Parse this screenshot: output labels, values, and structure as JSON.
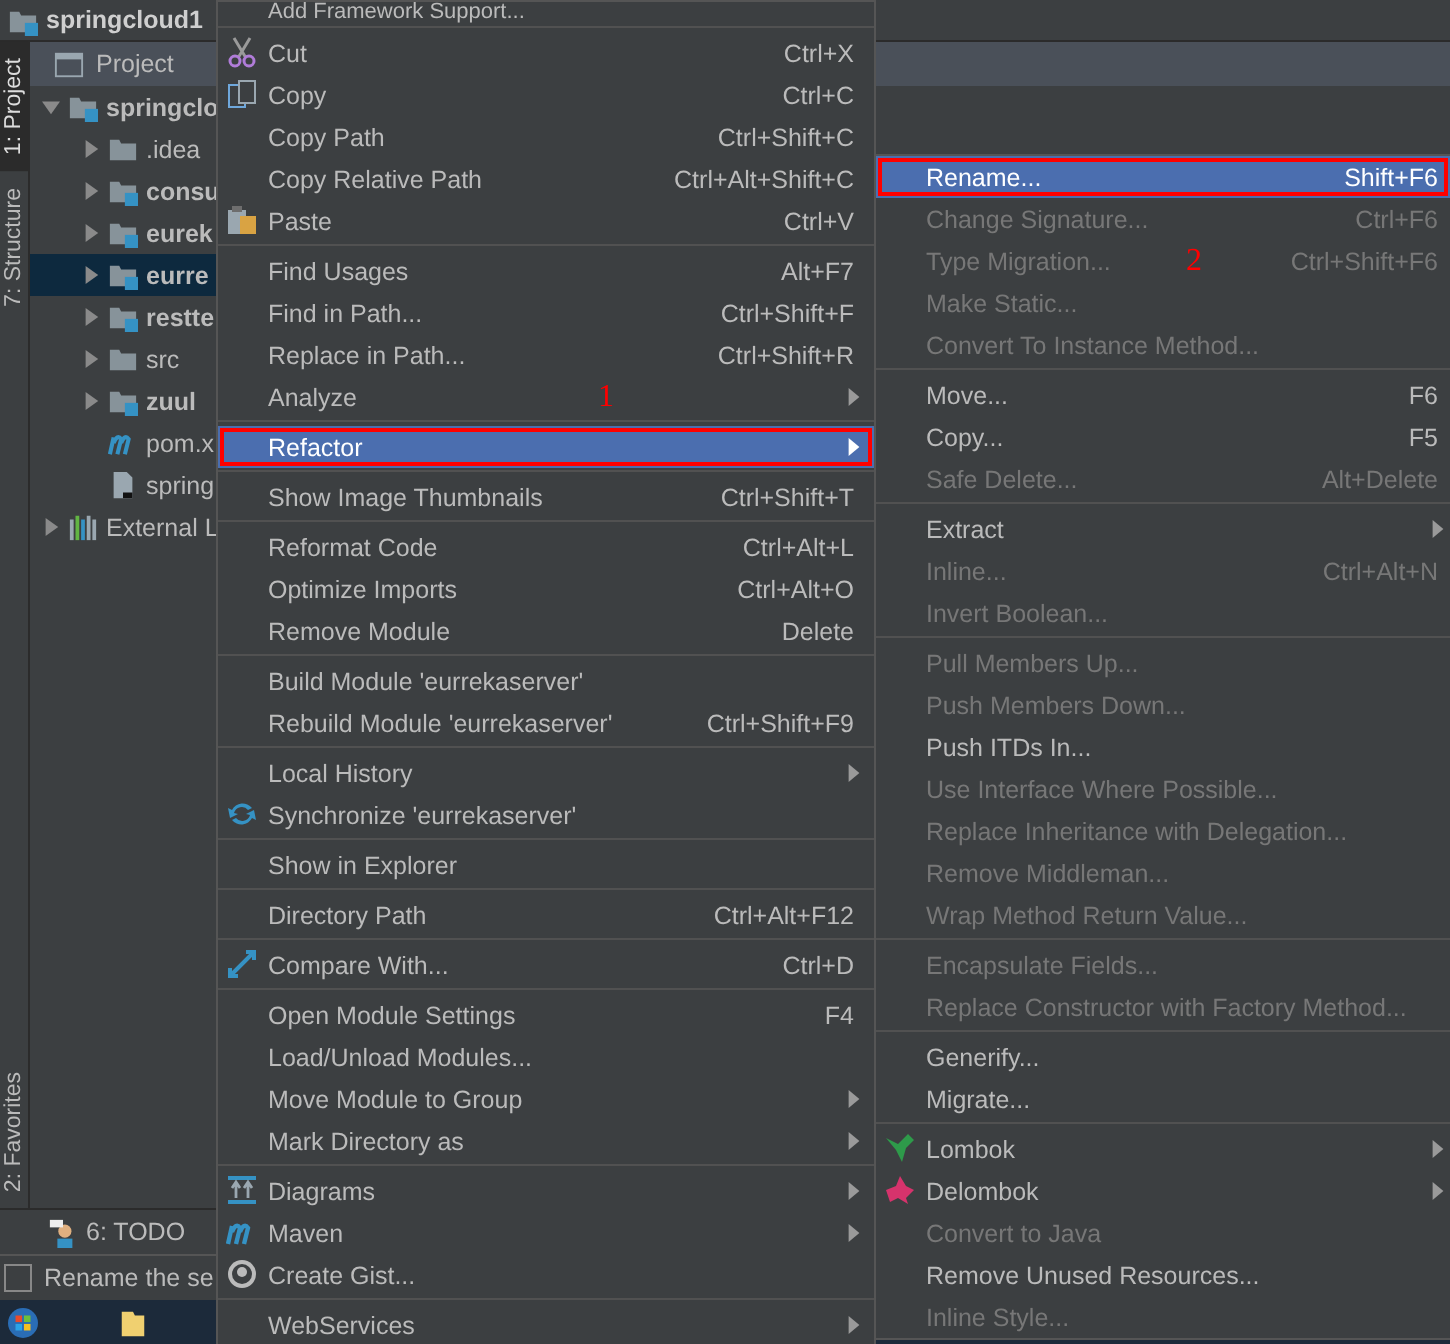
{
  "window": {
    "title": "springcloud1"
  },
  "tool_strip": {
    "top": [
      {
        "label": "1: Project",
        "selected": true
      },
      {
        "label": "7: Structure",
        "selected": false
      }
    ],
    "bottom": [
      {
        "label": "2: Favorites",
        "selected": false
      }
    ]
  },
  "project_panel": {
    "title": "Project",
    "tree": [
      {
        "label": "springclo",
        "kind": "module",
        "expanded": true,
        "selected": false,
        "children": [
          {
            "label": ".idea",
            "kind": "folder",
            "expanded": false,
            "selected": false
          },
          {
            "label": "consu",
            "kind": "module",
            "expanded": false,
            "selected": false
          },
          {
            "label": "eurek",
            "kind": "module",
            "expanded": false,
            "selected": false
          },
          {
            "label": "eurre",
            "kind": "module",
            "expanded": false,
            "selected": true
          },
          {
            "label": "restte",
            "kind": "module",
            "expanded": false,
            "selected": false
          },
          {
            "label": "src",
            "kind": "folder",
            "expanded": false,
            "selected": false
          },
          {
            "label": "zuul",
            "kind": "module",
            "expanded": false,
            "selected": false
          },
          {
            "label": "pom.x",
            "kind": "maven",
            "selected": false
          },
          {
            "label": "spring",
            "kind": "file",
            "selected": false
          }
        ]
      },
      {
        "label": "External L",
        "kind": "library",
        "expanded": false,
        "selected": false
      }
    ]
  },
  "tool_window_bar": {
    "tabs": [
      {
        "label": "6: TODO"
      }
    ]
  },
  "status_bar": {
    "text": "Rename the se"
  },
  "context_menu": {
    "groups": [
      [
        {
          "label": "Add Framework Support...",
          "kind": "cut"
        }
      ],
      [
        {
          "label": "Cut",
          "shortcut": "Ctrl+X",
          "disabled": false,
          "submenu": false,
          "selected": false
        },
        {
          "label": "Copy",
          "shortcut": "Ctrl+C",
          "disabled": false,
          "submenu": false,
          "selected": false
        },
        {
          "label": "Copy Path",
          "shortcut": "Ctrl+Shift+C",
          "disabled": false,
          "submenu": false,
          "selected": false
        },
        {
          "label": "Copy Relative Path",
          "shortcut": "Ctrl+Alt+Shift+C",
          "disabled": false,
          "submenu": false,
          "selected": false
        },
        {
          "label": "Paste",
          "shortcut": "Ctrl+V",
          "disabled": false,
          "submenu": false,
          "selected": false
        }
      ],
      [
        {
          "label": "Find Usages",
          "shortcut": "Alt+F7",
          "disabled": false,
          "submenu": false,
          "selected": false
        },
        {
          "label": "Find in Path...",
          "shortcut": "Ctrl+Shift+F",
          "disabled": false,
          "submenu": false,
          "selected": false
        },
        {
          "label": "Replace in Path...",
          "shortcut": "Ctrl+Shift+R",
          "disabled": false,
          "submenu": false,
          "selected": false
        },
        {
          "label": "Analyze",
          "annotation": "1",
          "disabled": false,
          "submenu": true,
          "selected": false
        }
      ],
      [
        {
          "label": "Refactor",
          "disabled": false,
          "submenu": true,
          "selected": true
        }
      ],
      [
        {
          "label": "Show Image Thumbnails",
          "shortcut": "Ctrl+Shift+T",
          "disabled": false,
          "submenu": false,
          "selected": false
        }
      ],
      [
        {
          "label": "Reformat Code",
          "shortcut": "Ctrl+Alt+L",
          "disabled": false,
          "submenu": false,
          "selected": false
        },
        {
          "label": "Optimize Imports",
          "shortcut": "Ctrl+Alt+O",
          "disabled": false,
          "submenu": false,
          "selected": false
        },
        {
          "label": "Remove Module",
          "shortcut": "Delete",
          "disabled": false,
          "submenu": false,
          "selected": false
        }
      ],
      [
        {
          "label": "Build Module 'eurrekaserver'",
          "disabled": false,
          "submenu": false,
          "selected": false
        },
        {
          "label": "Rebuild Module 'eurrekaserver'",
          "shortcut": "Ctrl+Shift+F9",
          "disabled": false,
          "submenu": false,
          "selected": false
        }
      ],
      [
        {
          "label": "Local History",
          "disabled": false,
          "submenu": true,
          "selected": false
        },
        {
          "label": "Synchronize 'eurrekaserver'",
          "disabled": false,
          "submenu": false,
          "selected": false
        }
      ],
      [
        {
          "label": "Show in Explorer",
          "disabled": false,
          "submenu": false,
          "selected": false
        }
      ],
      [
        {
          "label": "Directory Path",
          "shortcut": "Ctrl+Alt+F12",
          "disabled": false,
          "submenu": false,
          "selected": false
        }
      ],
      [
        {
          "label": "Compare With...",
          "shortcut": "Ctrl+D",
          "disabled": false,
          "submenu": false,
          "selected": false
        }
      ],
      [
        {
          "label": "Open Module Settings",
          "shortcut": "F4",
          "disabled": false,
          "submenu": false,
          "selected": false
        },
        {
          "label": "Load/Unload Modules...",
          "disabled": false,
          "submenu": false,
          "selected": false
        },
        {
          "label": "Move Module to Group",
          "disabled": false,
          "submenu": true,
          "selected": false
        },
        {
          "label": "Mark Directory as",
          "disabled": false,
          "submenu": true,
          "selected": false
        }
      ],
      [
        {
          "label": "Diagrams",
          "disabled": false,
          "submenu": true,
          "selected": false
        },
        {
          "label": "Maven",
          "disabled": false,
          "submenu": true,
          "selected": false
        },
        {
          "label": "Create Gist...",
          "disabled": false,
          "submenu": false,
          "selected": false
        }
      ],
      [
        {
          "label": "WebServices",
          "disabled": false,
          "submenu": true,
          "selected": false
        }
      ]
    ]
  },
  "refactor_submenu": {
    "groups": [
      [
        {
          "label": "Rename...",
          "shortcut": "Shift+F6",
          "disabled": false,
          "submenu": false,
          "selected": true
        },
        {
          "label": "Change Signature...",
          "shortcut": "Ctrl+F6",
          "disabled": true,
          "submenu": false,
          "selected": false
        },
        {
          "label": "Type Migration...",
          "shortcut": "Ctrl+Shift+F6",
          "annotation": "2",
          "disabled": true,
          "submenu": false,
          "selected": false
        },
        {
          "label": "Make Static...",
          "disabled": true,
          "submenu": false,
          "selected": false
        },
        {
          "label": "Convert To Instance Method...",
          "disabled": true,
          "submenu": false,
          "selected": false
        }
      ],
      [
        {
          "label": "Move...",
          "shortcut": "F6",
          "disabled": false,
          "submenu": false,
          "selected": false
        },
        {
          "label": "Copy...",
          "shortcut": "F5",
          "disabled": false,
          "submenu": false,
          "selected": false
        },
        {
          "label": "Safe Delete...",
          "shortcut": "Alt+Delete",
          "disabled": true,
          "submenu": false,
          "selected": false
        }
      ],
      [
        {
          "label": "Extract",
          "disabled": false,
          "submenu": true,
          "selected": false
        },
        {
          "label": "Inline...",
          "shortcut": "Ctrl+Alt+N",
          "disabled": true,
          "submenu": false,
          "selected": false
        },
        {
          "label": "Invert Boolean...",
          "disabled": true,
          "submenu": false,
          "selected": false
        }
      ],
      [
        {
          "label": "Pull Members Up...",
          "disabled": true,
          "submenu": false,
          "selected": false
        },
        {
          "label": "Push Members Down...",
          "disabled": true,
          "submenu": false,
          "selected": false
        },
        {
          "label": "Push ITDs In...",
          "disabled": false,
          "submenu": false,
          "selected": false
        },
        {
          "label": "Use Interface Where Possible...",
          "disabled": true,
          "submenu": false,
          "selected": false
        },
        {
          "label": "Replace Inheritance with Delegation...",
          "disabled": true,
          "submenu": false,
          "selected": false
        },
        {
          "label": "Remove Middleman...",
          "disabled": true,
          "submenu": false,
          "selected": false
        },
        {
          "label": "Wrap Method Return Value...",
          "disabled": true,
          "submenu": false,
          "selected": false
        }
      ],
      [
        {
          "label": "Encapsulate Fields...",
          "disabled": true,
          "submenu": false,
          "selected": false
        },
        {
          "label": "Replace Constructor with Factory Method...",
          "disabled": true,
          "submenu": false,
          "selected": false
        }
      ],
      [
        {
          "label": "Generify...",
          "disabled": false,
          "submenu": false,
          "selected": false
        },
        {
          "label": "Migrate...",
          "disabled": false,
          "submenu": false,
          "selected": false
        }
      ],
      [
        {
          "label": "Lombok",
          "disabled": false,
          "submenu": true,
          "selected": false
        },
        {
          "label": "Delombok",
          "disabled": false,
          "submenu": true,
          "selected": false
        },
        {
          "label": "Convert to Java",
          "disabled": true,
          "submenu": false,
          "selected": false
        },
        {
          "label": "Remove Unused Resources...",
          "disabled": false,
          "submenu": false,
          "selected": false
        },
        {
          "label": "Inline Style...",
          "disabled": true,
          "submenu": false,
          "selected": false
        }
      ]
    ]
  }
}
